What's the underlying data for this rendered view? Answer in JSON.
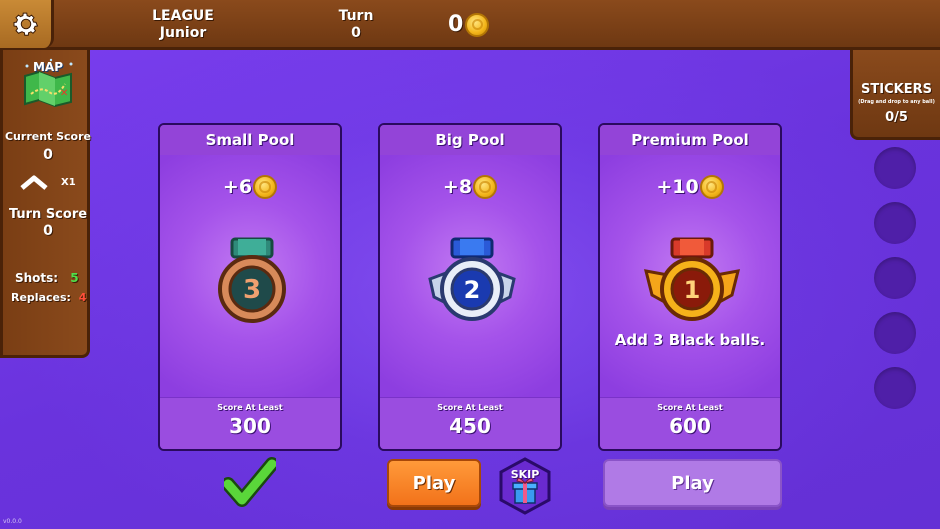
{
  "header": {
    "league_label": "LEAGUE",
    "league_value": "Junior",
    "turn_label": "Turn",
    "turn_value": "0",
    "coins": "0"
  },
  "left_panel": {
    "map_label": "MAP",
    "current_score_label": "Current Score",
    "current_score_value": "0",
    "multiplier": "X1",
    "turn_score_label": "Turn Score",
    "turn_score_value": "0",
    "shots_label": "Shots:",
    "shots_value": "5",
    "replaces_label": "Replaces:",
    "replaces_value": "4"
  },
  "stickers": {
    "title": "STICKERS",
    "hint": "(Drag and drop to any ball)",
    "count": "0/5",
    "slots": 5
  },
  "pools": [
    {
      "title": "Small Pool",
      "reward": "+6",
      "rank": "3",
      "description": "",
      "score_label": "Score At Least",
      "score_value": "300",
      "status": "completed",
      "colors": {
        "ribbon": "#2f8a7a",
        "ring": "#d88a5a",
        "core": "#1f4a4a"
      }
    },
    {
      "title": "Big Pool",
      "reward": "+8",
      "rank": "2",
      "description": "",
      "score_label": "Score At Least",
      "score_value": "450",
      "status": "available",
      "button_label": "Play",
      "colors": {
        "ribbon": "#2a5ad8",
        "ring": "#e8eef8",
        "core": "#1a3ab0"
      }
    },
    {
      "title": "Premium Pool",
      "reward": "+10",
      "rank": "1",
      "description": "Add 3 Black balls.",
      "score_label": "Score At Least",
      "score_value": "600",
      "status": "locked",
      "button_label": "Play",
      "colors": {
        "ribbon": "#d83a2a",
        "ring": "#f5b21a",
        "core": "#8a1a0a"
      }
    }
  ],
  "skip_label": "SKIP",
  "version": "v0.0.0"
}
